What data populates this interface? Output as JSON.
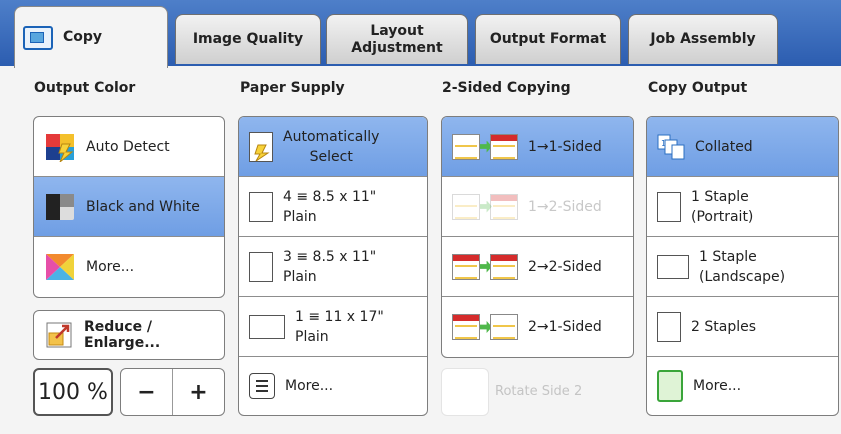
{
  "tabs": [
    {
      "label": "Copy",
      "active": true
    },
    {
      "label": "Image Quality"
    },
    {
      "label": "Layout\nAdjustment"
    },
    {
      "label": "Output Format"
    },
    {
      "label": "Job Assembly"
    }
  ],
  "output_color": {
    "title": "Output Color",
    "items": [
      {
        "label": "Auto Detect"
      },
      {
        "label": "Black and White",
        "selected": true
      },
      {
        "label": "More..."
      }
    ],
    "reduce_enlarge": "Reduce / Enlarge...",
    "zoom_value": "100 %",
    "minus": "−",
    "plus": "+"
  },
  "paper_supply": {
    "title": "Paper Supply",
    "items": [
      {
        "line1": "Automatically",
        "line2": "Select",
        "selected": true
      },
      {
        "line1": "4  ≡  8.5 x 11\"",
        "line2": "Plain"
      },
      {
        "line1": "3  ≡  8.5 x 11\"",
        "line2": "Plain"
      },
      {
        "line1": "1  ≡  11 x 17\"",
        "line2": "Plain"
      },
      {
        "line1": "More..."
      }
    ]
  },
  "two_sided": {
    "title": "2-Sided Copying",
    "items": [
      {
        "label": "1→1-Sided",
        "selected": true
      },
      {
        "label": "1→2-Sided",
        "disabled": true
      },
      {
        "label": "2→2-Sided"
      },
      {
        "label": "2→1-Sided"
      }
    ],
    "rotate_label": "Rotate Side 2"
  },
  "copy_output": {
    "title": "Copy Output",
    "items": [
      {
        "line1": "Collated",
        "selected": true
      },
      {
        "line1": "1 Staple",
        "line2": "(Portrait)"
      },
      {
        "line1": "1 Staple",
        "line2": "(Landscape)"
      },
      {
        "line1": "2 Staples"
      },
      {
        "line1": "More..."
      }
    ]
  }
}
